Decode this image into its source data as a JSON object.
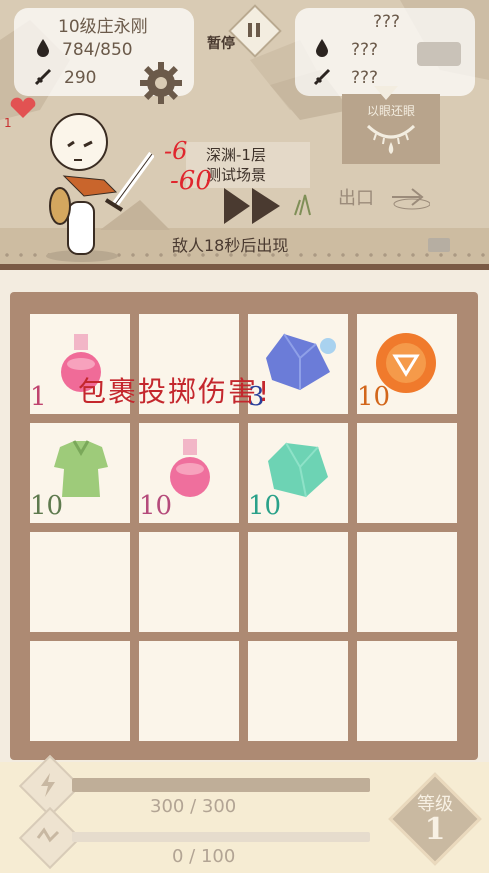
{
  "player": {
    "name": "10级庄永刚",
    "hp": "784/850",
    "attack": "290"
  },
  "enemy": {
    "name": "???",
    "hp": "???",
    "attack": "???",
    "skill_label": "以眼还眼"
  },
  "controls": {
    "pause_label": "暂停",
    "exit_label": "出口"
  },
  "level": {
    "line1": "深渊-1层",
    "line2": "测试场景"
  },
  "status": {
    "enemy_countdown": "敌人18秒后出现",
    "float_number": "1"
  },
  "damage": {
    "small": "-6",
    "big": "-60"
  },
  "inventory": {
    "banner": "包裹投掷伤害!",
    "slots": [
      {
        "item": "red-potion-icon",
        "count": "1",
        "color": "#c0446f"
      },
      {
        "item": "",
        "count": ""
      },
      {
        "item": "blue-crystal-icon",
        "count": "3",
        "color": "#2a3f9a"
      },
      {
        "item": "orange-coin-icon",
        "count": "10",
        "color": "#d2661b"
      },
      {
        "item": "green-armor-icon",
        "count": "10",
        "color": "#5e7a4e"
      },
      {
        "item": "pink-potion-icon",
        "count": "10",
        "color": "#b54b7b"
      },
      {
        "item": "teal-crystal-icon",
        "count": "10",
        "color": "#2aa189"
      },
      {
        "item": "",
        "count": ""
      }
    ]
  },
  "bars": {
    "energy_text": "300 / 300",
    "energy_fraction": 1.0,
    "exp_text": "0 / 100",
    "exp_fraction": 0.0
  },
  "badge": {
    "label": "等级",
    "value": "1"
  }
}
